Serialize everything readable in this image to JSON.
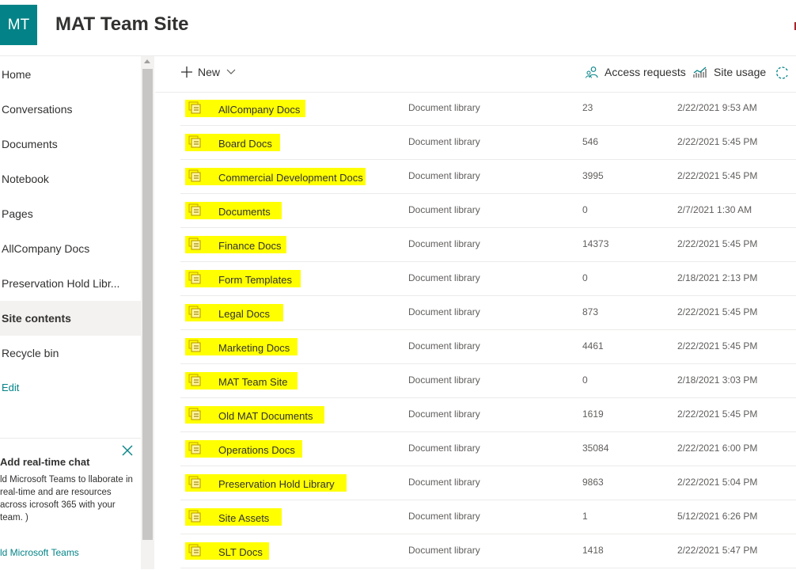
{
  "header": {
    "logo_text": "MT",
    "site_title": "MAT Team Site"
  },
  "nav": {
    "items": [
      {
        "label": "Home"
      },
      {
        "label": "Conversations"
      },
      {
        "label": "Documents"
      },
      {
        "label": "Notebook"
      },
      {
        "label": "Pages"
      },
      {
        "label": "AllCompany Docs"
      },
      {
        "label": "Preservation Hold Libr..."
      },
      {
        "label": "Site contents",
        "selected": true
      },
      {
        "label": "Recycle bin"
      }
    ],
    "edit_label": "Edit"
  },
  "chat_panel": {
    "title": "Add real-time chat",
    "body": "ld Microsoft Teams to llaborate in real-time and are resources across icrosoft 365 with your team. )",
    "link": "ld Microsoft Teams"
  },
  "command_bar": {
    "new_label": "New",
    "access_requests_label": "Access requests",
    "site_usage_label": "Site usage"
  },
  "list": {
    "rows": [
      {
        "name": "AllCompany Docs",
        "type": "Document library",
        "items": "23",
        "modified": "2/22/2021 9:53 AM",
        "hl": 152
      },
      {
        "name": "Board Docs",
        "type": "Document library",
        "items": "546",
        "modified": "2/22/2021 5:45 PM",
        "hl": 120
      },
      {
        "name": "Commercial Development Docs",
        "type": "Document library",
        "items": "3995",
        "modified": "2/22/2021 5:45 PM",
        "hl": 228
      },
      {
        "name": "Documents",
        "type": "Document library",
        "items": "0",
        "modified": "2/7/2021 1:30 AM",
        "hl": 122
      },
      {
        "name": "Finance Docs",
        "type": "Document library",
        "items": "14373",
        "modified": "2/22/2021 5:45 PM",
        "hl": 128
      },
      {
        "name": "Form Templates",
        "type": "Document library",
        "items": "0",
        "modified": "2/18/2021 2:13 PM",
        "hl": 146
      },
      {
        "name": "Legal Docs",
        "type": "Document library",
        "items": "873",
        "modified": "2/22/2021 5:45 PM",
        "hl": 124
      },
      {
        "name": "Marketing Docs",
        "type": "Document library",
        "items": "4461",
        "modified": "2/22/2021 5:45 PM",
        "hl": 142
      },
      {
        "name": "MAT Team Site",
        "type": "Document library",
        "items": "0",
        "modified": "2/18/2021 3:03 PM",
        "hl": 142
      },
      {
        "name": "Old MAT Documents",
        "type": "Document library",
        "items": "1619",
        "modified": "2/22/2021 5:45 PM",
        "hl": 176
      },
      {
        "name": "Operations Docs",
        "type": "Document library",
        "items": "35084",
        "modified": "2/22/2021 6:00 PM",
        "hl": 148
      },
      {
        "name": "Preservation Hold Library",
        "type": "Document library",
        "items": "9863",
        "modified": "2/22/2021 5:04 PM",
        "hl": 204
      },
      {
        "name": "Site Assets",
        "type": "Document library",
        "items": "1",
        "modified": "5/12/2021 6:26 PM",
        "hl": 122
      },
      {
        "name": "SLT Docs",
        "type": "Document library",
        "items": "1418",
        "modified": "2/22/2021 5:47 PM",
        "hl": 106
      }
    ]
  },
  "colors": {
    "brand": "#038387",
    "highlight": "#ffff00",
    "selected_bg": "#f3f2f1"
  }
}
